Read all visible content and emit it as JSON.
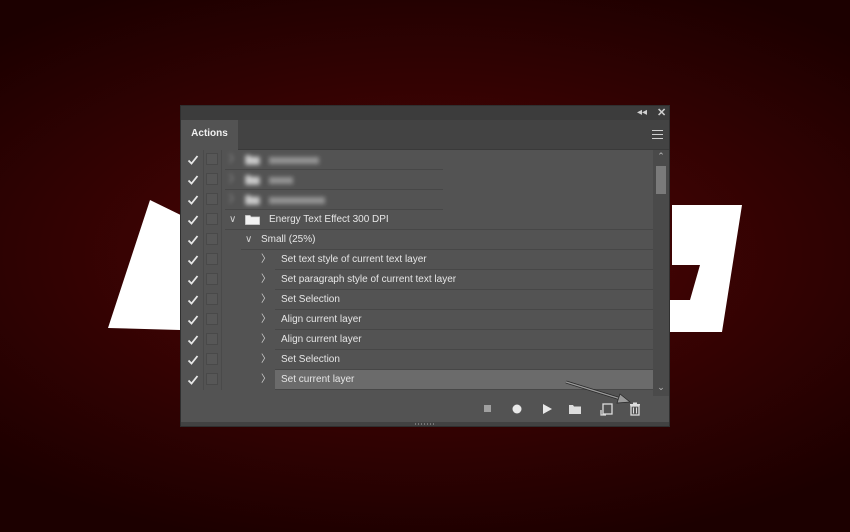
{
  "panel": {
    "tab_label": "Actions",
    "collapse_icon": "double-chevron-left-icon",
    "close_icon": "close-icon",
    "menu_icon": "hamburger-menu-icon"
  },
  "rows": [
    {
      "label": "",
      "blurred": true,
      "kind": "set"
    },
    {
      "label": "",
      "blurred": true,
      "kind": "set"
    },
    {
      "label": "",
      "blurred": true,
      "kind": "set"
    },
    {
      "label": "Energy Text Effect 300 DPI",
      "kind": "set"
    },
    {
      "label": "Small (25%)",
      "kind": "action"
    },
    {
      "label": "Set text style of current text layer",
      "kind": "step"
    },
    {
      "label": "Set paragraph style of current text layer",
      "kind": "step"
    },
    {
      "label": "Set Selection",
      "kind": "step"
    },
    {
      "label": "Align current layer",
      "kind": "step"
    },
    {
      "label": "Align current layer",
      "kind": "step"
    },
    {
      "label": "Set Selection",
      "kind": "step"
    },
    {
      "label": "Set current layer",
      "kind": "step",
      "selected": true
    }
  ],
  "footer": {
    "buttons": [
      "stop-icon",
      "record-icon",
      "play-icon",
      "new-set-folder-icon",
      "new-action-icon",
      "delete-trash-icon"
    ]
  },
  "colors": {
    "background": "#3a0303",
    "panel": "#535353",
    "selected_row": "#6b6b6b"
  }
}
